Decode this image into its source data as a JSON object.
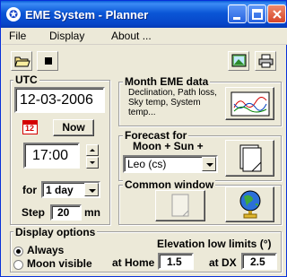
{
  "window": {
    "title": "EME System - Planner"
  },
  "menu": {
    "file": "File",
    "display": "Display",
    "about": "About ..."
  },
  "toolbar": {
    "open_icon": "open-folder-icon",
    "stop_icon": "stop-square-icon",
    "image_icon": "picture-icon",
    "print_icon": "printer-icon"
  },
  "utc": {
    "title": "UTC",
    "date": "12-03-2006",
    "calendar_day": "12",
    "now_label": "Now",
    "time": "17:00",
    "for_label": "for",
    "duration": "1 day",
    "step_label": "Step",
    "step_value": "20",
    "step_unit": "mn"
  },
  "month": {
    "title": "Month EME data",
    "description": "Declination, Path loss, Sky temp, System temp..."
  },
  "forecast": {
    "title": "Forecast for",
    "subtitle": "Moon + Sun +",
    "station": "Leo (cs)"
  },
  "common": {
    "title": "Common window"
  },
  "display_options": {
    "title": "Display options",
    "always": "Always",
    "moon_visible": "Moon visible",
    "selected": "Always"
  },
  "elevation": {
    "title": "Elevation low limits (°)",
    "home_label": "at Home",
    "home_value": "1.5",
    "dx_label": "at DX",
    "dx_value": "2.5"
  },
  "colors": {
    "title_bar": "#0a56d6",
    "window_bg": "#ece9d8",
    "accent_red": "#d40000"
  }
}
